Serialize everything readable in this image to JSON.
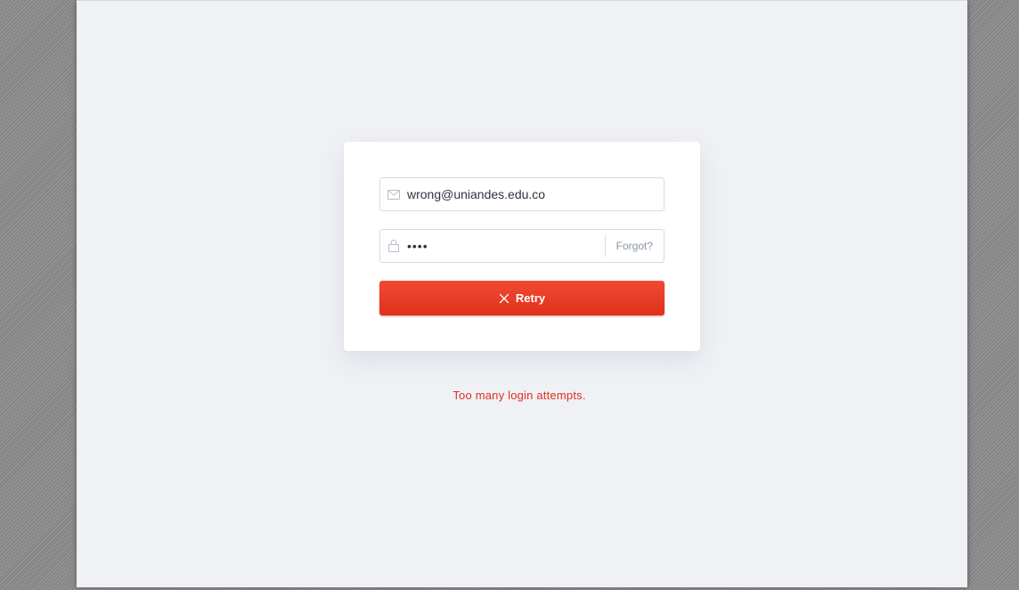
{
  "login": {
    "email": {
      "value": "wrong@uniandes.edu.co",
      "icon": "envelope-icon"
    },
    "password": {
      "value": "••••",
      "icon": "lock-icon",
      "forgot_label": "Forgot?"
    },
    "retry_button": {
      "label": "Retry",
      "icon": "close-icon"
    },
    "error_message": "Too many login attempts."
  },
  "colors": {
    "accent": "#e8382a",
    "error_text": "#e0301c",
    "page_bg": "#eff1f5",
    "card_bg": "#ffffff",
    "muted_text": "#8895a3"
  }
}
